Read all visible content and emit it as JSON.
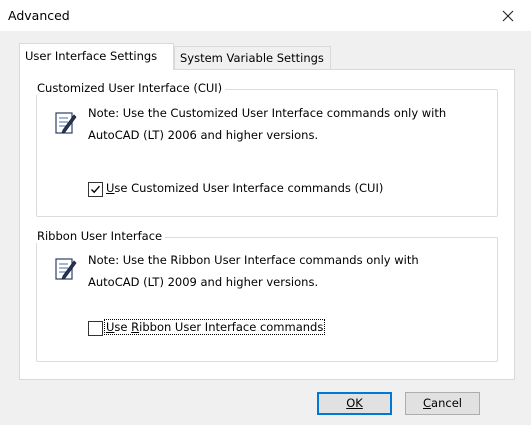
{
  "window": {
    "title": "Advanced",
    "close_glyph": "×"
  },
  "tabs": [
    {
      "label": "User Interface Settings",
      "active": true
    },
    {
      "label": "System Variable Settings",
      "active": false
    }
  ],
  "cui_group": {
    "legend": "Customized User Interface (CUI)",
    "note_line1": "Note: Use the Customized User Interface commands only with",
    "note_line2": "AutoCAD (LT) 2006 and higher versions.",
    "checkbox_label": "Use Customized User Interface commands (CUI)",
    "checked": true
  },
  "ribbon_group": {
    "legend": "Ribbon User Interface",
    "note_line1": "Note: Use the Ribbon User Interface commands only with",
    "note_line2": "AutoCAD (LT) 2009 and higher versions.",
    "checkbox_label": "Use Ribbon User Interface commands",
    "checked": false
  },
  "buttons": {
    "ok": "OK",
    "cancel": "Cancel"
  },
  "colors": {
    "default_button_border": "#0078d7",
    "dialog_bg": "#f0f0f0",
    "panel_bg": "#ffffff"
  }
}
